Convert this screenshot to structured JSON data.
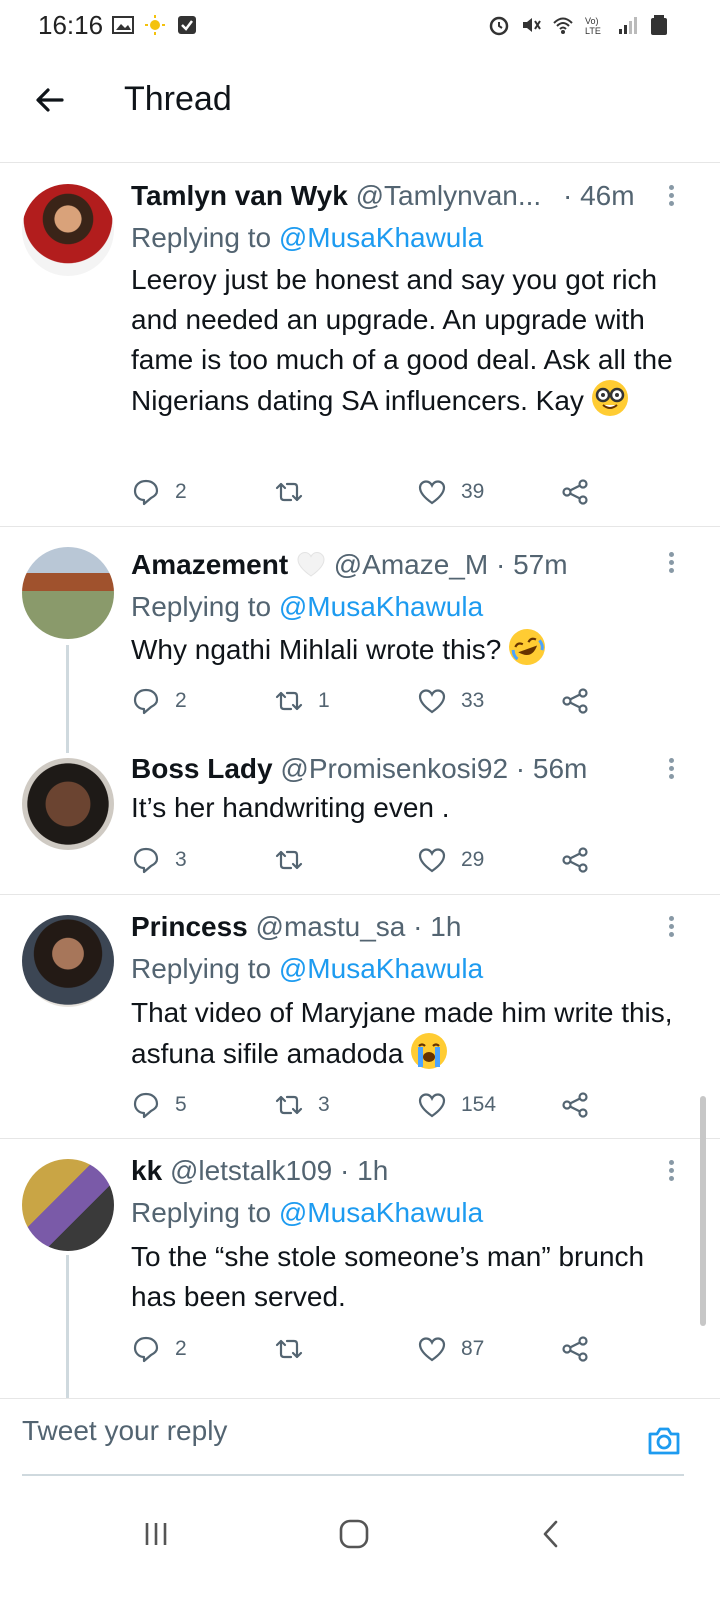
{
  "status_bar": {
    "time": "16:16"
  },
  "app_bar": {
    "title": "Thread"
  },
  "tweets": [
    {
      "name": "Tamlyn van Wyk",
      "handle": "@Tamlynvan...",
      "time": "· 46m",
      "replying_label": "Replying to",
      "replying_to": "@MusaKhawula",
      "text": "Leeroy just be honest and say you got rich and needed an upgrade. An upgrade with fame is too much of a good deal. Ask all the Nigerians dating SA influencers. Kay",
      "replies": "2",
      "retweets": "",
      "likes": "39"
    },
    {
      "name": "Amazement",
      "handle": "@Amaze_M",
      "time": "· 57m",
      "replying_label": "Replying to",
      "replying_to": "@MusaKhawula",
      "text": "Why ngathi Mihlali wrote this?",
      "replies": "2",
      "retweets": "1",
      "likes": "33"
    },
    {
      "name": "Boss Lady",
      "handle": "@Promisenkosi92",
      "time": "· 56m",
      "text": "It’s her handwriting even .",
      "replies": "3",
      "retweets": "",
      "likes": "29"
    },
    {
      "name": "Princess",
      "handle": "@mastu_sa",
      "time": "· 1h",
      "replying_label": "Replying to",
      "replying_to": "@MusaKhawula",
      "text": "That video of Maryjane made him write this, asfuna sifile amadoda",
      "replies": "5",
      "retweets": "3",
      "likes": "154"
    },
    {
      "name": "kk",
      "handle": "@letstalk109",
      "time": "· 1h",
      "replying_label": "Replying to",
      "replying_to": "@MusaKhawula",
      "text": "To the “she stole someone’s man” brunch has been served.",
      "replies": "2",
      "retweets": "",
      "likes": "87"
    }
  ],
  "reply_bar": {
    "placeholder": "Tweet your reply"
  },
  "colors": {
    "accent": "#1d9bf0",
    "secondary_text": "#536471",
    "divider": "#e6e6e6"
  }
}
